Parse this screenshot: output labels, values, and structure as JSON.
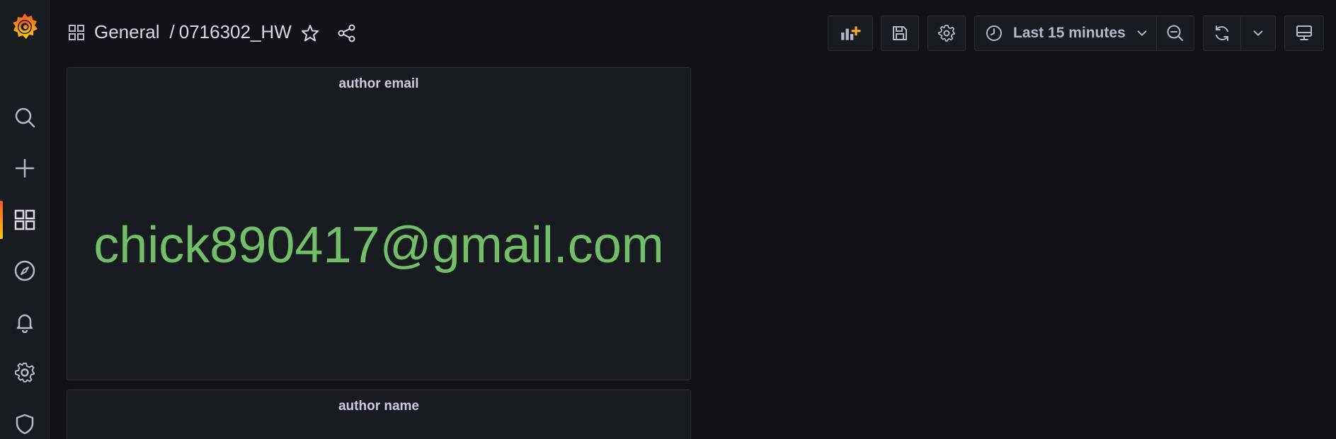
{
  "app": {
    "brand_colors": {
      "accent": "#f05a28",
      "value_green": "#73bf69",
      "background": "#111217",
      "panel": "#181b1f"
    }
  },
  "sidebar": {
    "items": [
      {
        "name": "search-icon"
      },
      {
        "name": "plus-icon"
      },
      {
        "name": "dashboards-icon",
        "active": true
      },
      {
        "name": "compass-icon"
      },
      {
        "name": "bell-icon"
      },
      {
        "name": "gear-icon"
      },
      {
        "name": "shield-icon"
      }
    ]
  },
  "header": {
    "folder": "General",
    "separator": "/",
    "dashboard_title": "0716302_HW",
    "time_range": "Last 15 minutes"
  },
  "panels": [
    {
      "title": "author email",
      "value": "chick890417@gmail.com"
    },
    {
      "title": "author name",
      "value": ""
    }
  ]
}
